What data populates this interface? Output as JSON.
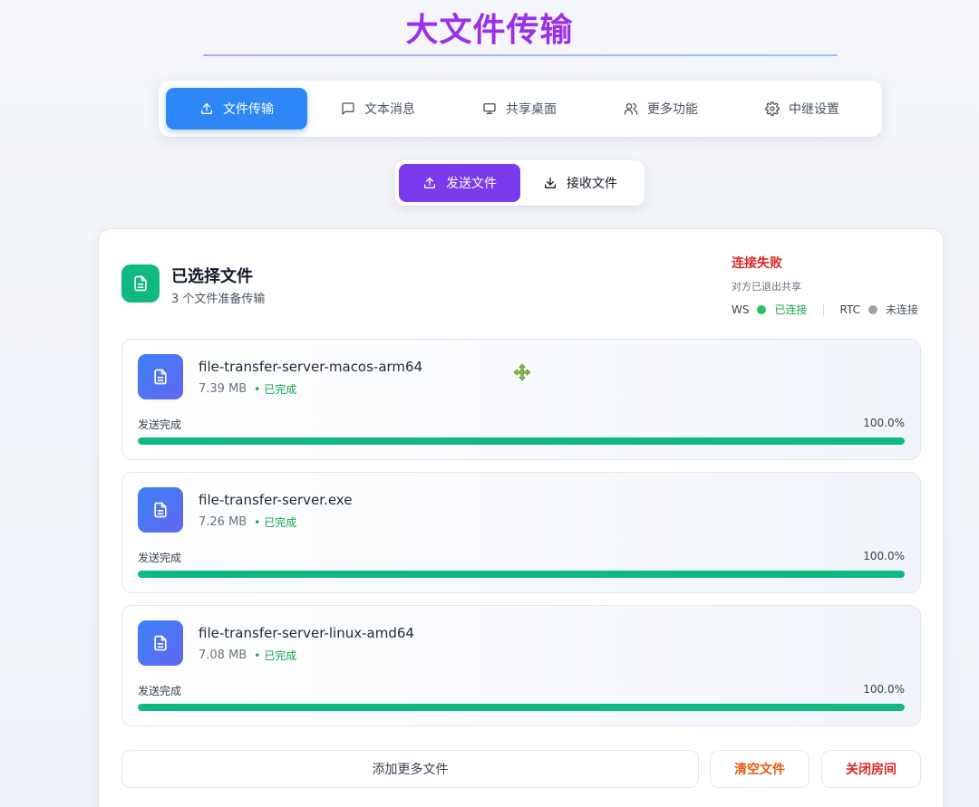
{
  "app": {
    "title": "大文件传输"
  },
  "nav": {
    "tabs": [
      {
        "label": "文件传输",
        "icon": "upload-icon",
        "active": true
      },
      {
        "label": "文本消息",
        "icon": "message-icon",
        "active": false
      },
      {
        "label": "共享桌面",
        "icon": "monitor-icon",
        "active": false
      },
      {
        "label": "更多功能",
        "icon": "users-icon",
        "active": false
      },
      {
        "label": "中继设置",
        "icon": "gear-icon",
        "active": false
      }
    ]
  },
  "subnav": {
    "send_label": "发送文件",
    "receive_label": "接收文件"
  },
  "card": {
    "title": "已选择文件",
    "subtitle": "3 个文件准备传输",
    "connection": {
      "status": "连接失败",
      "note": "对方已退出共享",
      "ws_label": "WS",
      "ws_state": "已连接",
      "rtc_label": "RTC",
      "rtc_state": "未连接",
      "separator": "|"
    },
    "files": [
      {
        "name": "file-transfer-server-macos-arm64",
        "size": "7.39 MB",
        "state": "已完成",
        "progress_label": "发送完成",
        "progress_text": "100.0%",
        "progress": 100
      },
      {
        "name": "file-transfer-server.exe",
        "size": "7.26 MB",
        "state": "已完成",
        "progress_label": "发送完成",
        "progress_text": "100.0%",
        "progress": 100
      },
      {
        "name": "file-transfer-server-linux-amd64",
        "size": "7.08 MB",
        "state": "已完成",
        "progress_label": "发送完成",
        "progress_text": "100.0%",
        "progress": 100
      }
    ],
    "actions": {
      "add_label": "添加更多文件",
      "clear_label": "清空文件",
      "close_label": "关闭房间"
    }
  },
  "colors": {
    "title": "#9b30e8",
    "nav_active": "#2f86f6",
    "subnav_active": "#7c3aed",
    "success": "#10b981",
    "error": "#dc2626",
    "warning": "#ea580c"
  }
}
